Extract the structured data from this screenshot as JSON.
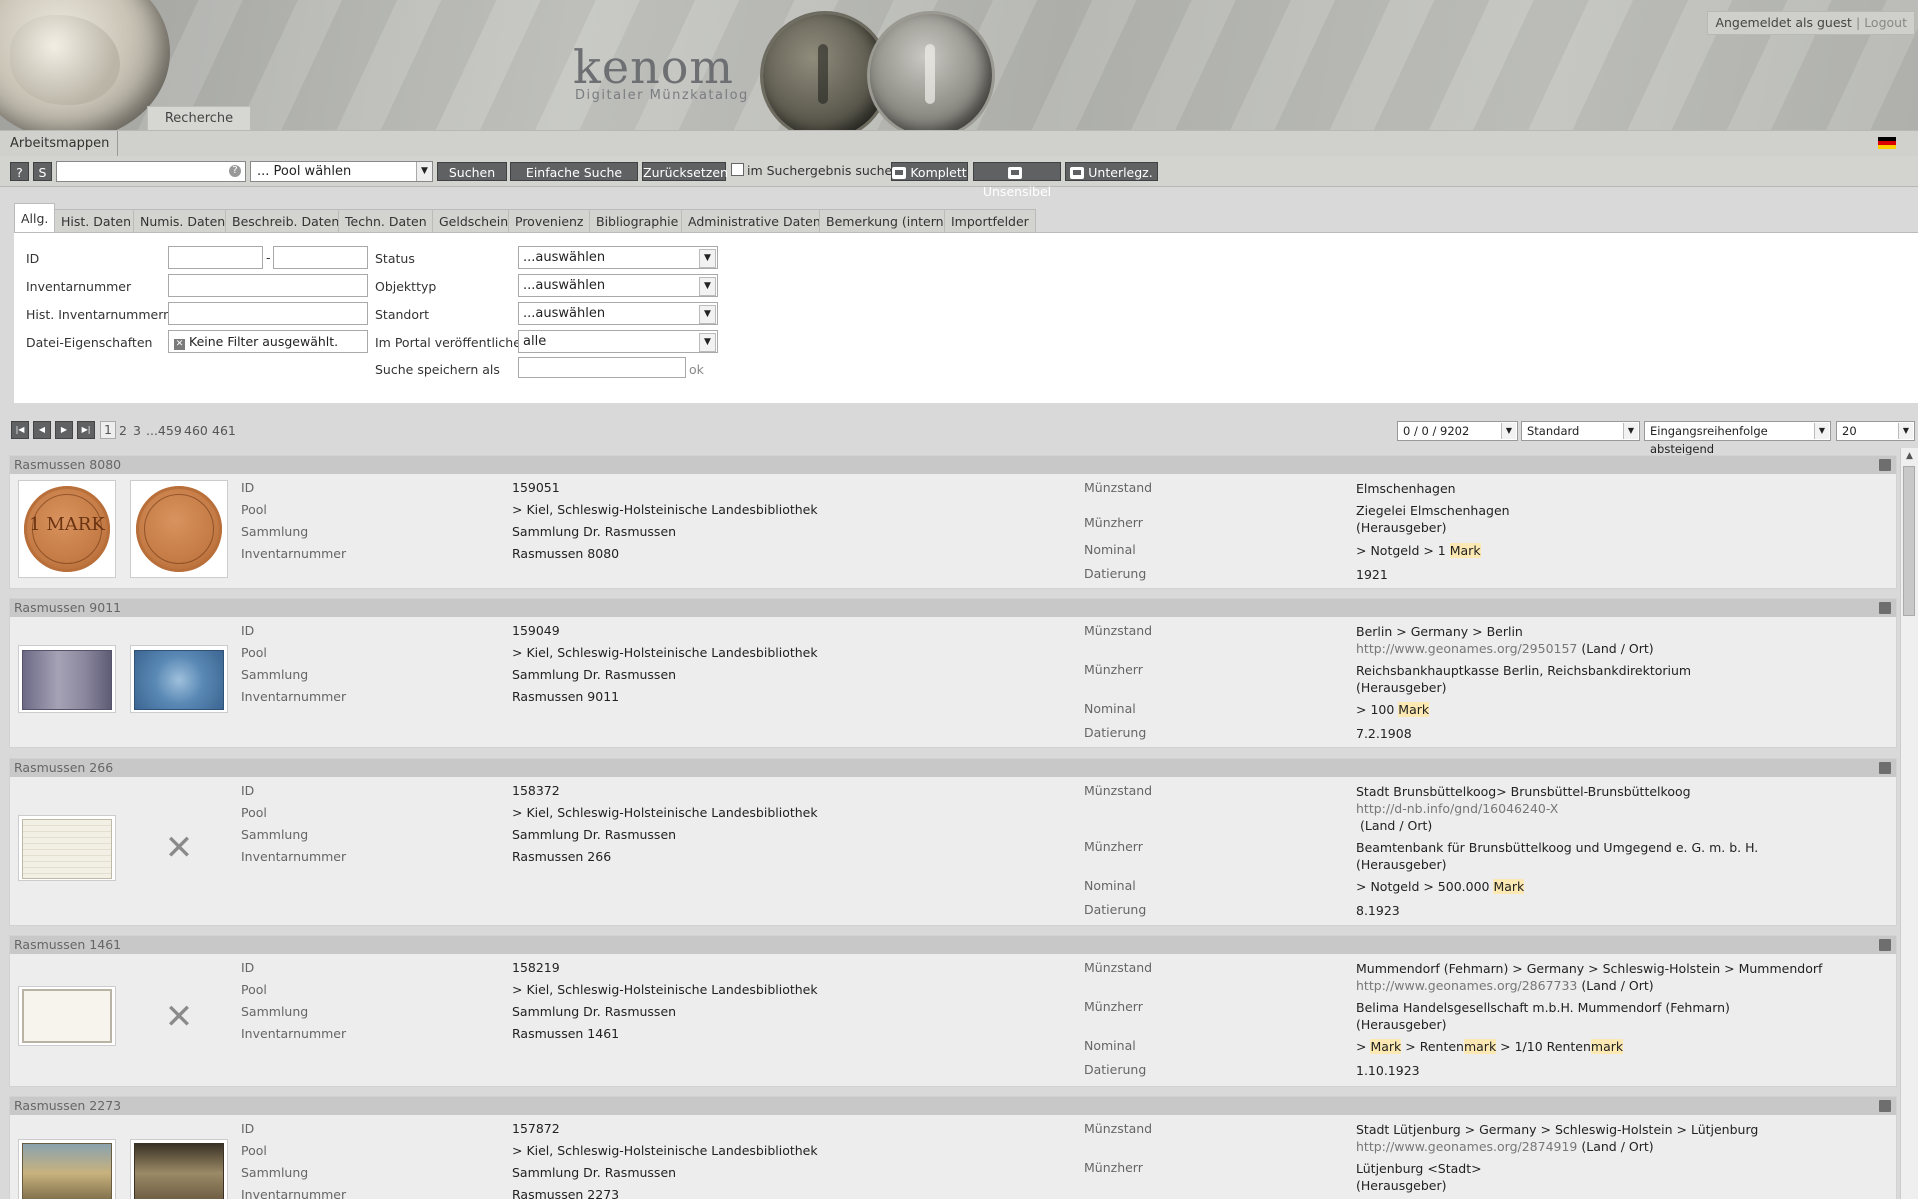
{
  "header": {
    "logo_title": "kenom",
    "logo_subtitle": "Digitaler Münzkatalog",
    "main_tab": "Recherche",
    "login_text": "Angemeldet als guest",
    "logout": "Logout"
  },
  "nav": {
    "workbooks": "Arbeitsmappen"
  },
  "toolbar": {
    "help_btn": "?",
    "s_btn": "S",
    "search_value": "",
    "pool_select": "... Pool wählen",
    "search_btn": "Suchen",
    "simple_search_btn": "Einfache Suche",
    "reset_btn": "Zurücksetzen",
    "in_results_label": "im Suchergebnis suchen",
    "komplett_btn": "Komplett",
    "unsensibel_btn": "Unsensibel",
    "unterlegz_btn": "Unterlegz."
  },
  "search_tabs": [
    "Allg.",
    "Hist. Daten",
    "Numis. Daten",
    "Beschreib. Daten",
    "Techn. Daten",
    "Geldschein",
    "Provenienz",
    "Bibliographie",
    "Administrative Daten",
    "Bemerkung (intern)",
    "Importfelder"
  ],
  "form": {
    "id_label": "ID",
    "id_sep": "-",
    "inventory_label": "Inventarnummer",
    "hist_inventory_label": "Hist. Inventarnummern",
    "file_props_label": "Datei-Eigenschaften",
    "file_props_value": "Keine Filter ausgewählt.",
    "status_label": "Status",
    "status_value": "...auswählen",
    "objecttype_label": "Objekttyp",
    "objecttype_value": "...auswählen",
    "location_label": "Standort",
    "location_value": "...auswählen",
    "portal_label": "Im Portal veröffentlichen",
    "portal_value": "alle",
    "save_label": "Suche speichern als",
    "save_ok": "ok"
  },
  "pager": {
    "pages": [
      "1",
      "2",
      "3",
      "...459",
      "460",
      "461"
    ],
    "count_select": "0 / 0 / 9202",
    "view_select": "Standard",
    "sort_select": "Eingangsreihenfolge absteigend",
    "per_page_select": "20"
  },
  "labels": {
    "id": "ID",
    "pool": "Pool",
    "collection": "Sammlung",
    "inventory": "Inventarnummer",
    "mint": "Münzstand",
    "issuer": "Münzherr",
    "nominal": "Nominal",
    "date": "Datierung"
  },
  "records": [
    {
      "title": "Rasmussen 8080",
      "id": "159051",
      "pool": "> Kiel, Schleswig-Holsteinische Landesbibliothek",
      "collection": "Sammlung Dr. Rasmussen",
      "inventory": "Rasmussen 8080",
      "mint": "Elmschenhagen",
      "mint_link": "",
      "mint_link_suffix": "",
      "issuer": "Ziegelei Elmschenhagen",
      "issuer_role": "(Herausgeber)",
      "nominal_pre": "> Notgeld > 1 ",
      "nominal_hl": "Mark",
      "date": "1921",
      "coin_front": "1 MARK",
      "coin_back": ""
    },
    {
      "title": "Rasmussen 9011",
      "id": "159049",
      "pool": "> Kiel, Schleswig-Holsteinische Landesbibliothek",
      "collection": "Sammlung Dr. Rasmussen",
      "inventory": "Rasmussen 9011",
      "mint": "Berlin > Germany > Berlin",
      "mint_link": "http://www.geonames.org/2950157",
      "mint_link_suffix": "(Land / Ort)",
      "issuer": "Reichsbankhauptkasse Berlin, Reichsbankdirektorium",
      "issuer_role": "(Herausgeber)",
      "nominal_pre": "> 100 ",
      "nominal_hl": "Mark",
      "date": "7.2.1908"
    },
    {
      "title": "Rasmussen 266",
      "id": "158372",
      "pool": "> Kiel, Schleswig-Holsteinische Landesbibliothek",
      "collection": "Sammlung Dr. Rasmussen",
      "inventory": "Rasmussen 266",
      "mint": "Stadt Brunsbüttelkoog> Brunsbüttel-Brunsbüttelkoog",
      "mint_link": "http://d-nb.info/gnd/16046240-X",
      "mint_link_suffix": "(Land / Ort)",
      "issuer": "Beamtenbank für Brunsbüttelkoog und Umgegend e. G. m. b. H.",
      "issuer_role": "(Herausgeber)",
      "nominal_pre": "> Notgeld > 500.000 ",
      "nominal_hl": "Mark",
      "date": "8.1923"
    },
    {
      "title": "Rasmussen 1461",
      "id": "158219",
      "pool": "> Kiel, Schleswig-Holsteinische Landesbibliothek",
      "collection": "Sammlung Dr. Rasmussen",
      "inventory": "Rasmussen 1461",
      "mint": "Mummendorf (Fehmarn) > Germany > Schleswig-Holstein > Mummendorf",
      "mint_link": "http://www.geonames.org/2867733",
      "mint_link_suffix": "(Land / Ort)",
      "issuer": "Belima Handelsgesellschaft m.b.H. Mummendorf (Fehmarn)",
      "issuer_role": "(Herausgeber)",
      "nominal_parts": [
        ">",
        " ",
        "Mark",
        " > Renten",
        "mark",
        " > 1/10 Renten",
        "mark"
      ],
      "date": "1.10.1923"
    },
    {
      "title": "Rasmussen 2273",
      "id": "157872",
      "pool": "> Kiel, Schleswig-Holsteinische Landesbibliothek",
      "collection": "Sammlung Dr. Rasmussen",
      "inventory": "Rasmussen 2273",
      "mint": "Stadt Lütjenburg > Germany > Schleswig-Holstein > Lütjenburg",
      "mint_link": "http://www.geonames.org/2874919",
      "mint_link_suffix": "(Land / Ort)",
      "issuer": "Lütjenburg <Stadt>",
      "issuer_role": "(Herausgeber)"
    }
  ],
  "colors": {
    "button_bg": "#5f6163",
    "highlight": "#fbe8b2",
    "header_bg": "#b6b7b2"
  }
}
